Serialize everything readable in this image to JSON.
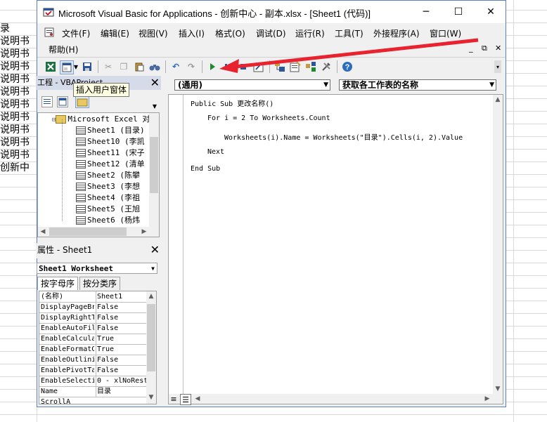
{
  "background": {
    "cells": [
      "录",
      "说明书",
      "说明书",
      "说明书",
      "说明书",
      "说明书",
      "说明书",
      "说明书",
      "说明书",
      "说明书",
      "说明书",
      "创新中"
    ]
  },
  "window": {
    "title": "Microsoft Visual Basic for Applications - 创新中心 - 副本.xlsx - [Sheet1 (代码)]",
    "controls": {
      "minimize": "─",
      "maximize": "☐",
      "close": "✕"
    }
  },
  "menu": {
    "items": [
      "文件(F)",
      "编辑(E)",
      "视图(V)",
      "插入(I)",
      "格式(O)",
      "调试(D)",
      "运行(R)",
      "工具(T)",
      "外接程序(A)",
      "窗口(W)"
    ],
    "help": "帮助(H)",
    "mdi": {
      "min": "_",
      "restore": "⧉",
      "close": "✕"
    }
  },
  "toolbar": {
    "tooltip": "插入用户窗体"
  },
  "project": {
    "title": "工程 - VBAProject",
    "root": "Microsoft Excel 对",
    "sheets": [
      "Sheet1 (目录)",
      "Sheet10 (李凯",
      "Sheet11 (宋子",
      "Sheet12 (清单",
      "Sheet2 (陈攀",
      "Sheet3 (李想",
      "Sheet4 (李祖",
      "Sheet5 (王旭",
      "Sheet6 (杨炜"
    ]
  },
  "properties": {
    "title": "属性 - Sheet1",
    "object": "Sheet1 Worksheet",
    "tabs": [
      "按字母序",
      "按分类序"
    ],
    "rows": [
      {
        "name": "(名称)",
        "value": "Sheet1"
      },
      {
        "name": "DisplayPageBr",
        "value": "False"
      },
      {
        "name": "DisplayRightT",
        "value": "False"
      },
      {
        "name": "EnableAutoFil",
        "value": "False"
      },
      {
        "name": "EnableCalcula",
        "value": "True"
      },
      {
        "name": "EnableFormatC",
        "value": "True"
      },
      {
        "name": "EnableOutlini",
        "value": "False"
      },
      {
        "name": "EnablePivotTa",
        "value": "False"
      },
      {
        "name": "EnableSelecti",
        "value": "0 - xlNoRest"
      },
      {
        "name": "Name",
        "value": "目录"
      },
      {
        "name": "ScrollA",
        "value": ""
      }
    ]
  },
  "code": {
    "object_combo": "(通用)",
    "proc_combo": "获取各工作表的名称",
    "lines": [
      "Public Sub 更改名称()",
      "For i = 2 To Worksheets.Count",
      "Worksheets(i).Name = Worksheets(\"目录\").Cells(i, 2).Value",
      "Next",
      "End Sub"
    ]
  }
}
